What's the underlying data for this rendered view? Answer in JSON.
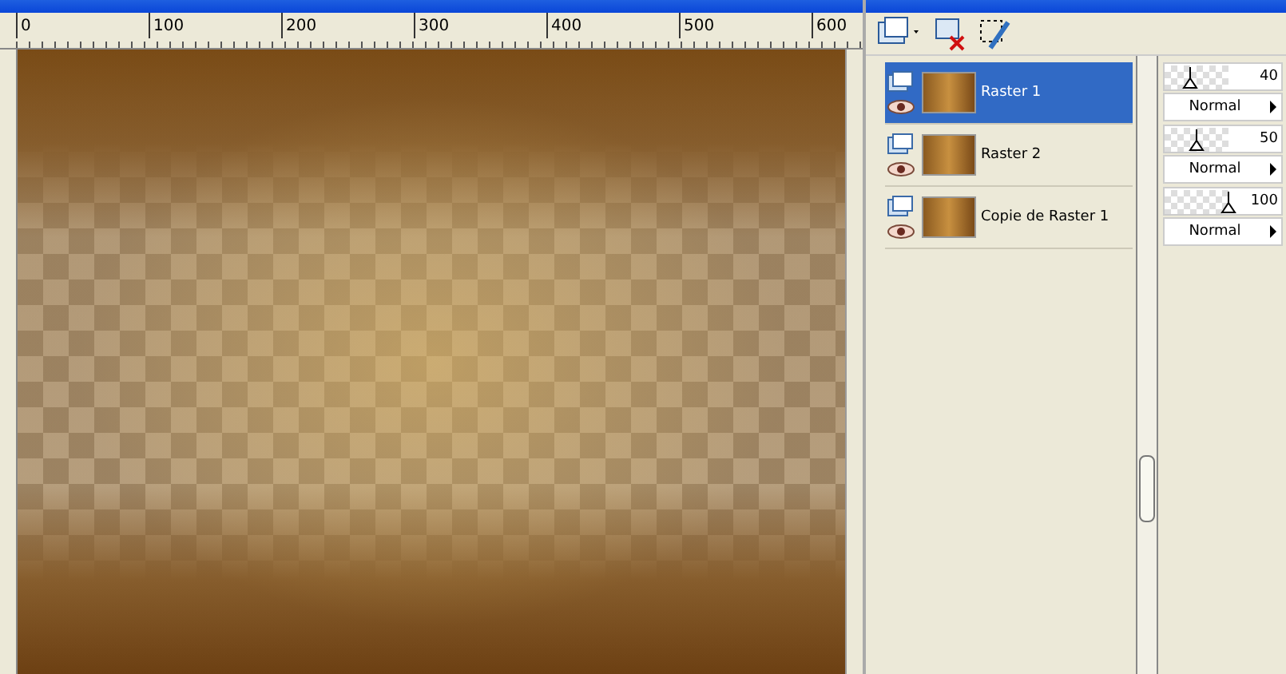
{
  "ruler": {
    "labels": [
      "0",
      "100",
      "200",
      "300",
      "400",
      "500",
      "600"
    ]
  },
  "layers": [
    {
      "name": "Raster 1",
      "selected": true,
      "opacity": "40",
      "level": 0.4,
      "blend_mode": "Normal"
    },
    {
      "name": "Raster 2",
      "selected": false,
      "opacity": "50",
      "level": 0.5,
      "blend_mode": "Normal"
    },
    {
      "name": "Copie de Raster 1",
      "selected": false,
      "opacity": "100",
      "level": 1,
      "blend_mode": "Normal"
    }
  ]
}
